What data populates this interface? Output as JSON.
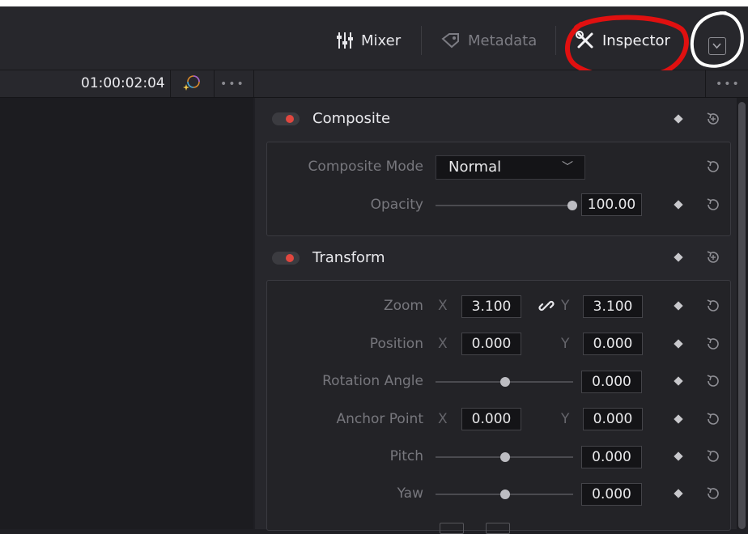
{
  "header": {
    "tabs": [
      {
        "label": "Mixer",
        "icon": "mixer-icon",
        "active": false
      },
      {
        "label": "Metadata",
        "icon": "metadata-icon",
        "active": false
      },
      {
        "label": "Inspector",
        "icon": "inspector-icon",
        "active": true
      }
    ],
    "collapse_icon": "chevron-down-icon"
  },
  "viewer": {
    "timecode": "01:00:02:04",
    "more_label": "•••"
  },
  "inspector": {
    "more_label": "•••",
    "sections": {
      "composite": {
        "title": "Composite",
        "mode_label": "Composite Mode",
        "mode_value": "Normal",
        "opacity_label": "Opacity",
        "opacity_value": "100.00"
      },
      "transform": {
        "title": "Transform",
        "zoom_label": "Zoom",
        "zoom_x": "3.100",
        "zoom_y": "3.100",
        "position_label": "Position",
        "position_x": "0.000",
        "position_y": "0.000",
        "rotation_label": "Rotation Angle",
        "rotation_value": "0.000",
        "anchor_label": "Anchor Point",
        "anchor_x": "0.000",
        "anchor_y": "0.000",
        "pitch_label": "Pitch",
        "pitch_value": "0.000",
        "yaw_label": "Yaw",
        "yaw_value": "0.000",
        "x_label": "X",
        "y_label": "Y"
      }
    }
  },
  "colors": {
    "accent_red": "#e0473f",
    "annotation_red": "#e01010",
    "panel_bg": "#27272c"
  }
}
